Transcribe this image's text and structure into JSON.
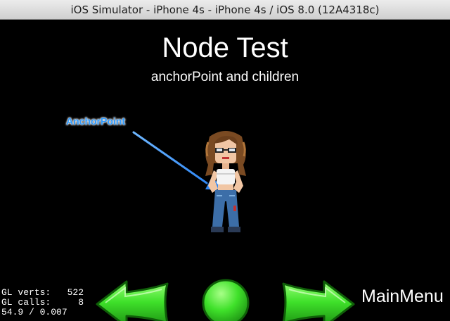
{
  "window": {
    "title": "iOS Simulator - iPhone 4s - iPhone 4s / iOS 8.0 (12A4318c)"
  },
  "scene": {
    "title": "Node Test",
    "subtitle": "anchorPoint and children",
    "anchor_label": "AnchorPoint"
  },
  "stats": {
    "line1": "GL verts:   522",
    "line2": "GL calls:     8",
    "line3": "54.9 / 0.007"
  },
  "menu": {
    "main_menu_label": "MainMenu"
  },
  "colors": {
    "button_green": "#3fe12a",
    "button_green_dark": "#1c8f12",
    "arrow_blue": "#2f87f5",
    "label_blue": "#2f9bff"
  },
  "icons": {
    "back": "left-arrow-icon",
    "restart": "circle-icon",
    "next": "right-arrow-icon"
  }
}
